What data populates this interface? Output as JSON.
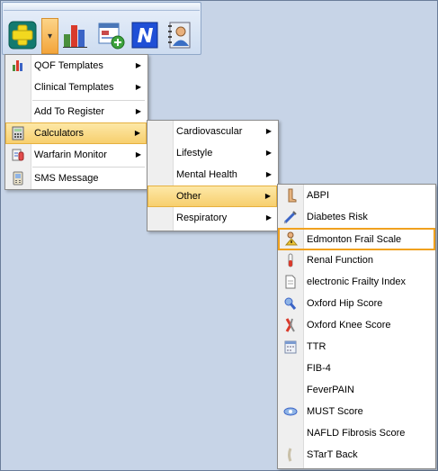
{
  "toolbar": {
    "buttons": [
      {
        "icon": "add-consultation-icon"
      },
      {
        "icon": "dropdown-chevron-icon"
      },
      {
        "icon": "bar-chart-icon"
      },
      {
        "icon": "add-template-icon"
      },
      {
        "icon": "n-logo-icon"
      },
      {
        "icon": "patient-record-icon"
      }
    ],
    "dropdown_arrow": "▾"
  },
  "menu1": {
    "items": [
      {
        "label": "QOF Templates",
        "icon": "bar-chart-icon",
        "submenu": true
      },
      {
        "label": "Clinical Templates",
        "icon": "",
        "submenu": true
      },
      {
        "label": "Add To Register",
        "icon": "",
        "submenu": true
      },
      {
        "label": "Calculators",
        "icon": "calculator-icon",
        "submenu": true,
        "highlighted": true
      },
      {
        "label": "Warfarin Monitor",
        "icon": "warfarin-icon",
        "submenu": true
      },
      {
        "label": "SMS Message",
        "icon": "sms-icon",
        "submenu": false
      }
    ]
  },
  "menu2": {
    "items": [
      {
        "label": "Cardiovascular",
        "submenu": true
      },
      {
        "label": "Lifestyle",
        "submenu": true
      },
      {
        "label": "Mental Health",
        "submenu": true
      },
      {
        "label": "Other",
        "submenu": true,
        "highlighted": true
      },
      {
        "label": "Respiratory",
        "submenu": true
      }
    ]
  },
  "menu3": {
    "items": [
      {
        "label": "ABPI",
        "icon": "leg-icon"
      },
      {
        "label": "Diabetes Risk",
        "icon": "syringe-icon"
      },
      {
        "label": "Edmonton Frail Scale",
        "icon": "frail-person-icon",
        "selected": true
      },
      {
        "label": "Renal Function",
        "icon": "test-tube-icon"
      },
      {
        "label": "electronic Frailty Index",
        "icon": "document-icon"
      },
      {
        "label": "Oxford Hip Score",
        "icon": "hip-icon"
      },
      {
        "label": "Oxford Knee Score",
        "icon": "knee-icon"
      },
      {
        "label": "TTR",
        "icon": "calendar-icon"
      },
      {
        "label": "FIB-4",
        "icon": ""
      },
      {
        "label": "FeverPAIN",
        "icon": ""
      },
      {
        "label": "MUST Score",
        "icon": "must-icon"
      },
      {
        "label": "NAFLD Fibrosis Score",
        "icon": ""
      },
      {
        "label": "STarT Back",
        "icon": "back-icon"
      }
    ]
  },
  "submenu_arrow": "▶",
  "colors": {
    "highlight": "#f7cf6e",
    "selection_border": "#f0a11e",
    "background": "#c7d4e7"
  }
}
